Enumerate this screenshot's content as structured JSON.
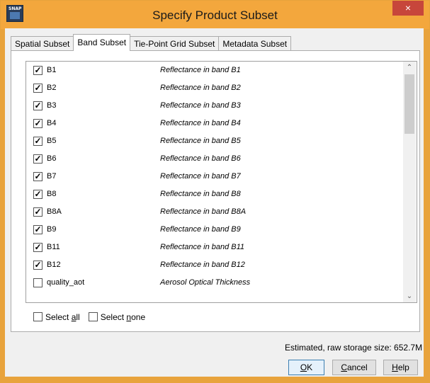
{
  "window": {
    "title": "Specify Product Subset",
    "close": "×",
    "app_icon_text": "SNAP"
  },
  "tabs": [
    {
      "label": "Spatial Subset",
      "active": false
    },
    {
      "label": "Band Subset",
      "active": true
    },
    {
      "label": "Tie-Point Grid Subset",
      "active": false
    },
    {
      "label": "Metadata Subset",
      "active": false
    }
  ],
  "bands": [
    {
      "name": "B1",
      "desc": "Reflectance in band B1",
      "checked": true
    },
    {
      "name": "B2",
      "desc": "Reflectance in band B2",
      "checked": true
    },
    {
      "name": "B3",
      "desc": "Reflectance in band B3",
      "checked": true
    },
    {
      "name": "B4",
      "desc": "Reflectance in band B4",
      "checked": true
    },
    {
      "name": "B5",
      "desc": "Reflectance in band B5",
      "checked": true
    },
    {
      "name": "B6",
      "desc": "Reflectance in band B6",
      "checked": true
    },
    {
      "name": "B7",
      "desc": "Reflectance in band B7",
      "checked": true
    },
    {
      "name": "B8",
      "desc": "Reflectance in band B8",
      "checked": true
    },
    {
      "name": "B8A",
      "desc": "Reflectance in band B8A",
      "checked": true
    },
    {
      "name": "B9",
      "desc": "Reflectance in band B9",
      "checked": true
    },
    {
      "name": "B11",
      "desc": "Reflectance in band B11",
      "checked": true
    },
    {
      "name": "B12",
      "desc": "Reflectance in band B12",
      "checked": true
    },
    {
      "name": "quality_aot",
      "desc": "Aerosol Optical Thickness",
      "checked": false
    }
  ],
  "select": {
    "all_prefix": "Select ",
    "all_key": "a",
    "all_suffix": "ll",
    "none_prefix": "Select ",
    "none_key": "n",
    "none_suffix": "one"
  },
  "estimate": "Estimated, raw storage size: 652.7M",
  "buttons": {
    "ok_key": "O",
    "ok_rest": "K",
    "cancel_key": "C",
    "cancel_rest": "ancel",
    "help_key": "H",
    "help_rest": "elp"
  },
  "colors": {
    "titlebar": "#f3a73d",
    "close": "#c7463b"
  }
}
